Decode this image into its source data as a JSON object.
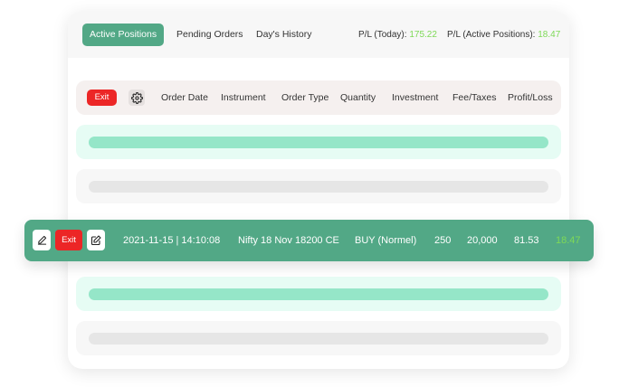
{
  "tabs": {
    "active_positions": "Active Positions",
    "pending_orders": "Pending Orders",
    "days_history": "Day's History"
  },
  "pl": {
    "today_label": "P/L (Today):",
    "today_value": "175.22",
    "active_label": "P/L (Active Positions):",
    "active_value": "18.47"
  },
  "header": {
    "exit_label": "Exit",
    "columns": [
      "Order Date",
      "Instrument",
      "Order Type",
      "Quantity",
      "Investment",
      "Fee/Taxes",
      "Profit/Loss"
    ]
  },
  "row": {
    "exit_label": "Exit",
    "order_date": "2021-11-15 | 14:10:08",
    "instrument": "Nifty 18 Nov 18200 CE",
    "order_type": "BUY (Normel)",
    "quantity": "250",
    "investment": "20,000",
    "fee_taxes": "81.53",
    "profit_loss": "18.47"
  },
  "icons": {
    "settings": "gear-icon",
    "edit": "pencil-icon",
    "edit_square": "edit-square-icon"
  },
  "colors": {
    "accent": "#52a886",
    "danger": "#ec2626",
    "profit": "#7ed957",
    "placeholder_green": "#95e6c8",
    "placeholder_grey": "#e6e6e6"
  }
}
